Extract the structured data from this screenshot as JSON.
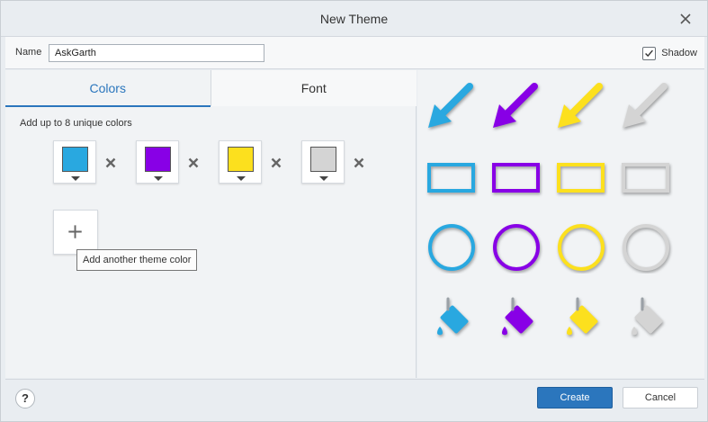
{
  "dialog": {
    "title": "New Theme"
  },
  "name_row": {
    "label": "Name",
    "value": "AskGarth",
    "shadow_label": "Shadow",
    "shadow_checked": true
  },
  "tabs": [
    {
      "label": "Colors",
      "active": true
    },
    {
      "label": "Font",
      "active": false
    }
  ],
  "colors_panel": {
    "hint": "Add up to 8 unique colors",
    "swatches": [
      {
        "color": "#29a8e0"
      },
      {
        "color": "#8800e6"
      },
      {
        "color": "#fce01e"
      },
      {
        "color": "#d4d4d4"
      }
    ],
    "add_tooltip": "Add another theme color"
  },
  "preview": {
    "colors": [
      "#29a8e0",
      "#8800e6",
      "#fce01e",
      "#d4d4d4"
    ],
    "rows": [
      "arrow-icon",
      "rectangle-icon",
      "circle-icon",
      "fill-bucket-icon"
    ]
  },
  "footer": {
    "help_label": "?",
    "create_label": "Create",
    "cancel_label": "Cancel"
  }
}
